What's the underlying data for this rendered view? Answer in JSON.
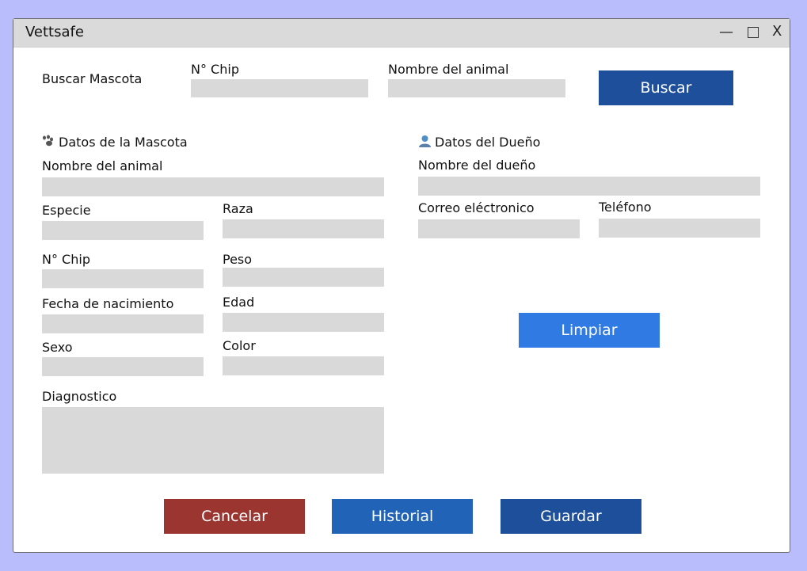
{
  "window": {
    "title": "Vettsafe",
    "min_glyph": "—",
    "close_glyph": "X"
  },
  "search": {
    "label": "Buscar Mascota",
    "chip_label": "N° Chip",
    "chip_value": "",
    "name_label": "Nombre del animal",
    "name_value": "",
    "button_label": "Buscar"
  },
  "pet": {
    "header": "Datos de la Mascota",
    "icon": "paw-icon",
    "name_label": "Nombre del animal",
    "species_label": "Especie",
    "breed_label": "Raza",
    "chip_label": "N° Chip",
    "weight_label": "Peso",
    "birthdate_label": "Fecha de nacimiento",
    "age_label": "Edad",
    "sex_label": "Sexo",
    "color_label": "Color",
    "diagnosis_label": "Diagnostico"
  },
  "owner": {
    "header": "Datos del Dueño",
    "icon": "person-icon",
    "name_label": "Nombre del dueño",
    "email_label": "Correo eléctronico",
    "phone_label": "Teléfono"
  },
  "buttons": {
    "clear": "Limpiar",
    "cancel": "Cancelar",
    "history": "Historial",
    "save": "Guardar"
  },
  "colors": {
    "background": "#b9bdfc",
    "field": "#d9d9d9",
    "primary_dark": "#1d4f9b",
    "primary_light": "#2f7be3",
    "history": "#2163b7",
    "cancel": "#9a3530"
  }
}
